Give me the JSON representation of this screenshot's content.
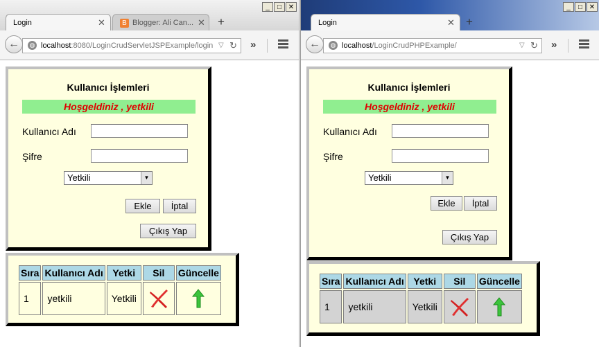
{
  "windows": [
    {
      "tabs": [
        {
          "label": "Login",
          "active": true
        },
        {
          "label": "Blogger: Ali Can...",
          "active": false,
          "icon": "blogger-icon"
        }
      ],
      "url": {
        "host": "localhost",
        "path": ":8080/LoginCrudServletJSPExample/login"
      },
      "page": {
        "title": "Kullanıcı İşlemleri",
        "welcome": "Hoşgeldiniz , yetkili",
        "username_label": "Kullanıcı Adı",
        "username_value": "",
        "password_label": "Şifre",
        "password_value": "",
        "role_selected": "Yetkili",
        "add_button": "Ekle",
        "cancel_button": "İptal",
        "logout_button": "Çıkış Yap"
      },
      "table": {
        "headers": [
          "Sıra",
          "Kullanıcı Adı",
          "Yetki",
          "Sil",
          "Güncelle"
        ],
        "rows": [
          {
            "sira": "1",
            "kullanici": "yetkili",
            "yetki": "Yetkili"
          }
        ]
      }
    },
    {
      "tabs": [
        {
          "label": "Login",
          "active": true
        }
      ],
      "url": {
        "host": "localhost",
        "path": "/LoginCrudPHPExample/"
      },
      "page": {
        "title": "Kullanıcı İşlemleri",
        "welcome": "Hoşgeldiniz , yetkili",
        "username_label": "Kullanıcı Adı",
        "username_value": "",
        "password_label": "Şifre",
        "password_value": "",
        "role_selected": "Yetkili",
        "add_button": "Ekle",
        "cancel_button": "İptal",
        "logout_button": "Çıkış Yap"
      },
      "table": {
        "headers": [
          "Sıra",
          "Kullanıcı Adı",
          "Yetki",
          "Sil",
          "Güncelle"
        ],
        "rows": [
          {
            "sira": "1",
            "kullanici": "yetkili",
            "yetki": "Yetkili"
          }
        ]
      }
    }
  ],
  "colors": {
    "panel_bg": "#ffffe0",
    "welcome_bg": "#90ee90",
    "welcome_text": "#e00000",
    "table_header_bg": "#add8e6",
    "right_row_bg": "#d3d3d3"
  }
}
